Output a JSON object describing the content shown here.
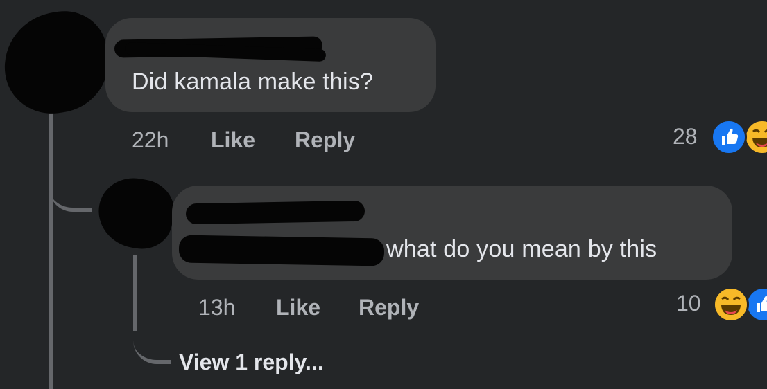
{
  "comment": {
    "text": "Did kamala make this?",
    "time": "22h",
    "like_label": "Like",
    "reply_label": "Reply",
    "reaction_count": "28",
    "reactions": [
      "like-icon",
      "haha-icon"
    ]
  },
  "reply": {
    "text": "what do you mean by this",
    "time": "13h",
    "like_label": "Like",
    "reply_label": "Reply",
    "reaction_count": "10",
    "reactions": [
      "haha-icon",
      "like-icon"
    ]
  },
  "view_more": {
    "label": "View 1 reply..."
  },
  "colors": {
    "background": "#242628",
    "bubble": "#3a3b3c",
    "text": "#e4e6eb",
    "muted": "#b0b3b8",
    "like_blue": "#1877f2",
    "haha_yellow": "#f7b928"
  }
}
